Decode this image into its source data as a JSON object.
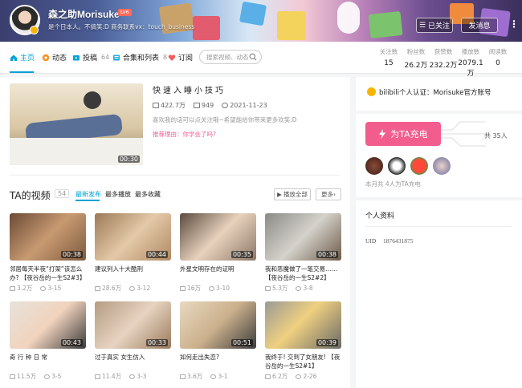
{
  "header": {
    "username": "森之助Morisuke",
    "level": "LV6",
    "signature": "是个日本人。不搞笑:D 商务联系vx：touch_business",
    "followed_label": "已关注",
    "message_label": "发消息",
    "more_label": "⋮"
  },
  "nav": {
    "items": [
      {
        "label": "主页",
        "icon": "home-icon"
      },
      {
        "label": "动态",
        "icon": "dynamic-icon"
      },
      {
        "label": "投稿",
        "count": "64",
        "icon": "upload-icon"
      },
      {
        "label": "合集和列表",
        "count": "8",
        "icon": "collection-icon"
      },
      {
        "label": "订阅",
        "icon": "heart-icon"
      }
    ],
    "search_placeholder": "搜索视频、动态",
    "stats": [
      {
        "label": "关注数",
        "value": "15"
      },
      {
        "label": "粉丝数",
        "value": "26.2万"
      },
      {
        "label": "获赞数",
        "value": "232.2万"
      },
      {
        "label": "播放数",
        "value": "2079.1万"
      },
      {
        "label": "阅读数",
        "value": "0"
      }
    ]
  },
  "featured": {
    "title": "快速入睡小技巧",
    "duration": "00:30",
    "views": "422.7万",
    "danmaku": "949",
    "date": "2021-11-23",
    "desc": "喜欢我的话可以点关注哦~希望能给你带来更多欢笑:D",
    "reason": "推荐理由：你学会了吗?"
  },
  "videos_section": {
    "title": "TA的视频",
    "count": "54",
    "tabs": [
      "最新发布",
      "最多播放",
      "最多收藏"
    ],
    "play_all": "播放全部",
    "more": "更多"
  },
  "videos": [
    {
      "title": "邻居每天半夜“打架”该怎么办? 【夜谷岳的一生S2#3】",
      "duration": "00:38",
      "views": "3.2万",
      "date": "3-15"
    },
    {
      "title": "建议列入十大酷刑",
      "duration": "00:44",
      "views": "28.6万",
      "date": "3-12"
    },
    {
      "title": "外星文明存在的证明",
      "duration": "00:35",
      "views": "16万",
      "date": "3-10"
    },
    {
      "title": "我和恶魔做了一笔交易…… 【夜谷岳的一生S2#2】",
      "duration": "00:38",
      "views": "5.3万",
      "date": "3-8"
    },
    {
      "title": "奇 行 种 日 常",
      "duration": "00:43",
      "views": "11.5万",
      "date": "3-5"
    },
    {
      "title": "过于真实 女生仿入",
      "duration": "00:33",
      "views": "11.4万",
      "date": "3-3"
    },
    {
      "title": "如何走出失恋?",
      "duration": "00:51",
      "views": "3.6万",
      "date": "3-1"
    },
    {
      "title": "我终于! 交到了女朋友! 【夜谷岳的一生S2#1】",
      "duration": "00:39",
      "views": "6.2万",
      "date": "2-26"
    }
  ],
  "sidebar": {
    "verify": "bilibili个人认证：Morisuke官方账号",
    "charge_label": "为TA充电",
    "total": "共 35人",
    "month_note": "本月共 4人为TA充电",
    "info_title": "个人资料",
    "uid_label": "UID",
    "uid_value": "1876431875"
  },
  "colors": {
    "accent": "#00a1d6",
    "pink": "#f25d8e"
  }
}
